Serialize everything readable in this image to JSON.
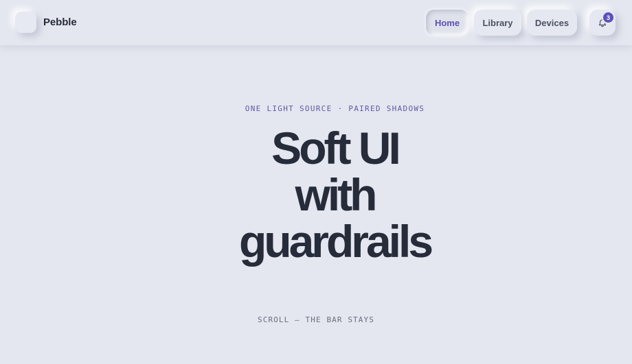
{
  "brand": {
    "name": "Pebble"
  },
  "nav": {
    "items": [
      {
        "label": "Home",
        "active": true
      },
      {
        "label": "Library",
        "active": false
      },
      {
        "label": "Devices",
        "active": false
      }
    ],
    "notifications": {
      "icon": "bell-icon",
      "count": "3"
    }
  },
  "hero": {
    "eyebrow": "ONE LIGHT SOURCE · PAIRED SHADOWS",
    "title_lines": [
      "Soft UI",
      "with",
      "guardrails"
    ]
  },
  "scroll_hint": "SCROLL — THE BAR STAYS",
  "colors": {
    "background": "#e4e7ef",
    "accent": "#5a4fb8",
    "badge": "#5b50bd",
    "title": "#272c3a"
  }
}
